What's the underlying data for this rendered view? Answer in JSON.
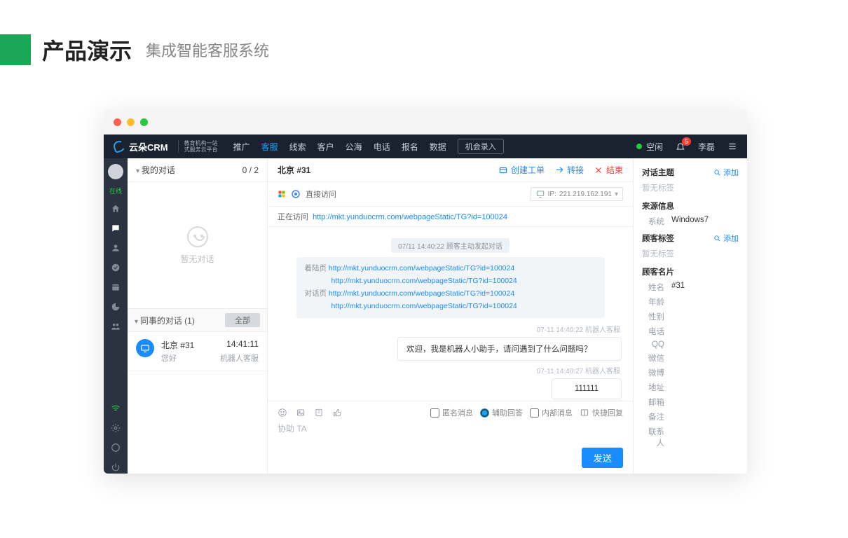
{
  "slide": {
    "title": "产品演示",
    "subtitle": "集成智能客服系统"
  },
  "brand": {
    "name": "云朵CRM",
    "tag1": "教育机构一站",
    "tag2": "式服务云平台"
  },
  "nav": {
    "items": [
      "推广",
      "客服",
      "线索",
      "客户",
      "公海",
      "电话",
      "报名",
      "数据"
    ],
    "active": 1,
    "record_btn": "机会录入",
    "status": "空闲",
    "notif_count": "5",
    "user": "李磊"
  },
  "rail": {
    "online": "在线"
  },
  "convs": {
    "my_header": "我的对话",
    "my_count": "0 / 2",
    "empty": "暂无对话",
    "col_header": "同事的对话  (1)",
    "all_tab": "全部",
    "item": {
      "title": "北京  #31",
      "msg": "您好",
      "time": "14:41:11",
      "src": "机器人客服"
    }
  },
  "chat": {
    "title": "北京  #31",
    "actions": {
      "ticket": "创建工单",
      "transfer": "转接",
      "end": "结束"
    },
    "access": "直接访问",
    "ip_label": "IP:",
    "ip": "221.219.162.191",
    "visiting_label": "正在访问",
    "visiting_url": "http://mkt.yunduocrm.com/webpageStatic/TG?id=100024",
    "sys": "07/11 14:40:22  顾客主动发起对话",
    "ref": {
      "landing_label": "着陆页",
      "landing_a": "http://mkt.yunduocrm.com/webpageStatic/TG?id=100024",
      "landing_b": "http://mkt.yunduocrm.com/webpageStatic/TG?id=100024",
      "dialog_label": "对话页",
      "dialog_a": "http://mkt.yunduocrm.com/webpageStatic/TG?id=100024",
      "dialog_b": "http://mkt.yunduocrm.com/webpageStatic/TG?id=100024"
    },
    "msgs": [
      {
        "stamp": "07-11 14:40:22  机器人客服",
        "text": "欢迎，我是机器人小助手，请问遇到了什么问题吗？"
      },
      {
        "stamp": "07-11 14:40:27  机器人客服",
        "text": "111111"
      }
    ],
    "composer": {
      "anon": "匿名消息",
      "assist": "辅助回答",
      "internal": "内部消息",
      "quick": "快捷回复",
      "placeholder": "协助 TA",
      "send": "发送"
    }
  },
  "info": {
    "topic_hd": "对话主题",
    "add": "添加",
    "no_tag": "暂无标签",
    "source_hd": "来源信息",
    "sys_label": "系统",
    "sys_val": "Windows7",
    "ctag_hd": "顾客标签",
    "card_hd": "顾客名片",
    "card": {
      "name_k": "姓名",
      "name_v": "#31",
      "age": "年龄",
      "sex": "性别",
      "phone": "电话",
      "qq": "QQ",
      "wechat": "微信",
      "weibo": "微博",
      "addr": "地址",
      "mail": "邮箱",
      "note": "备注",
      "contact": "联系人"
    }
  }
}
